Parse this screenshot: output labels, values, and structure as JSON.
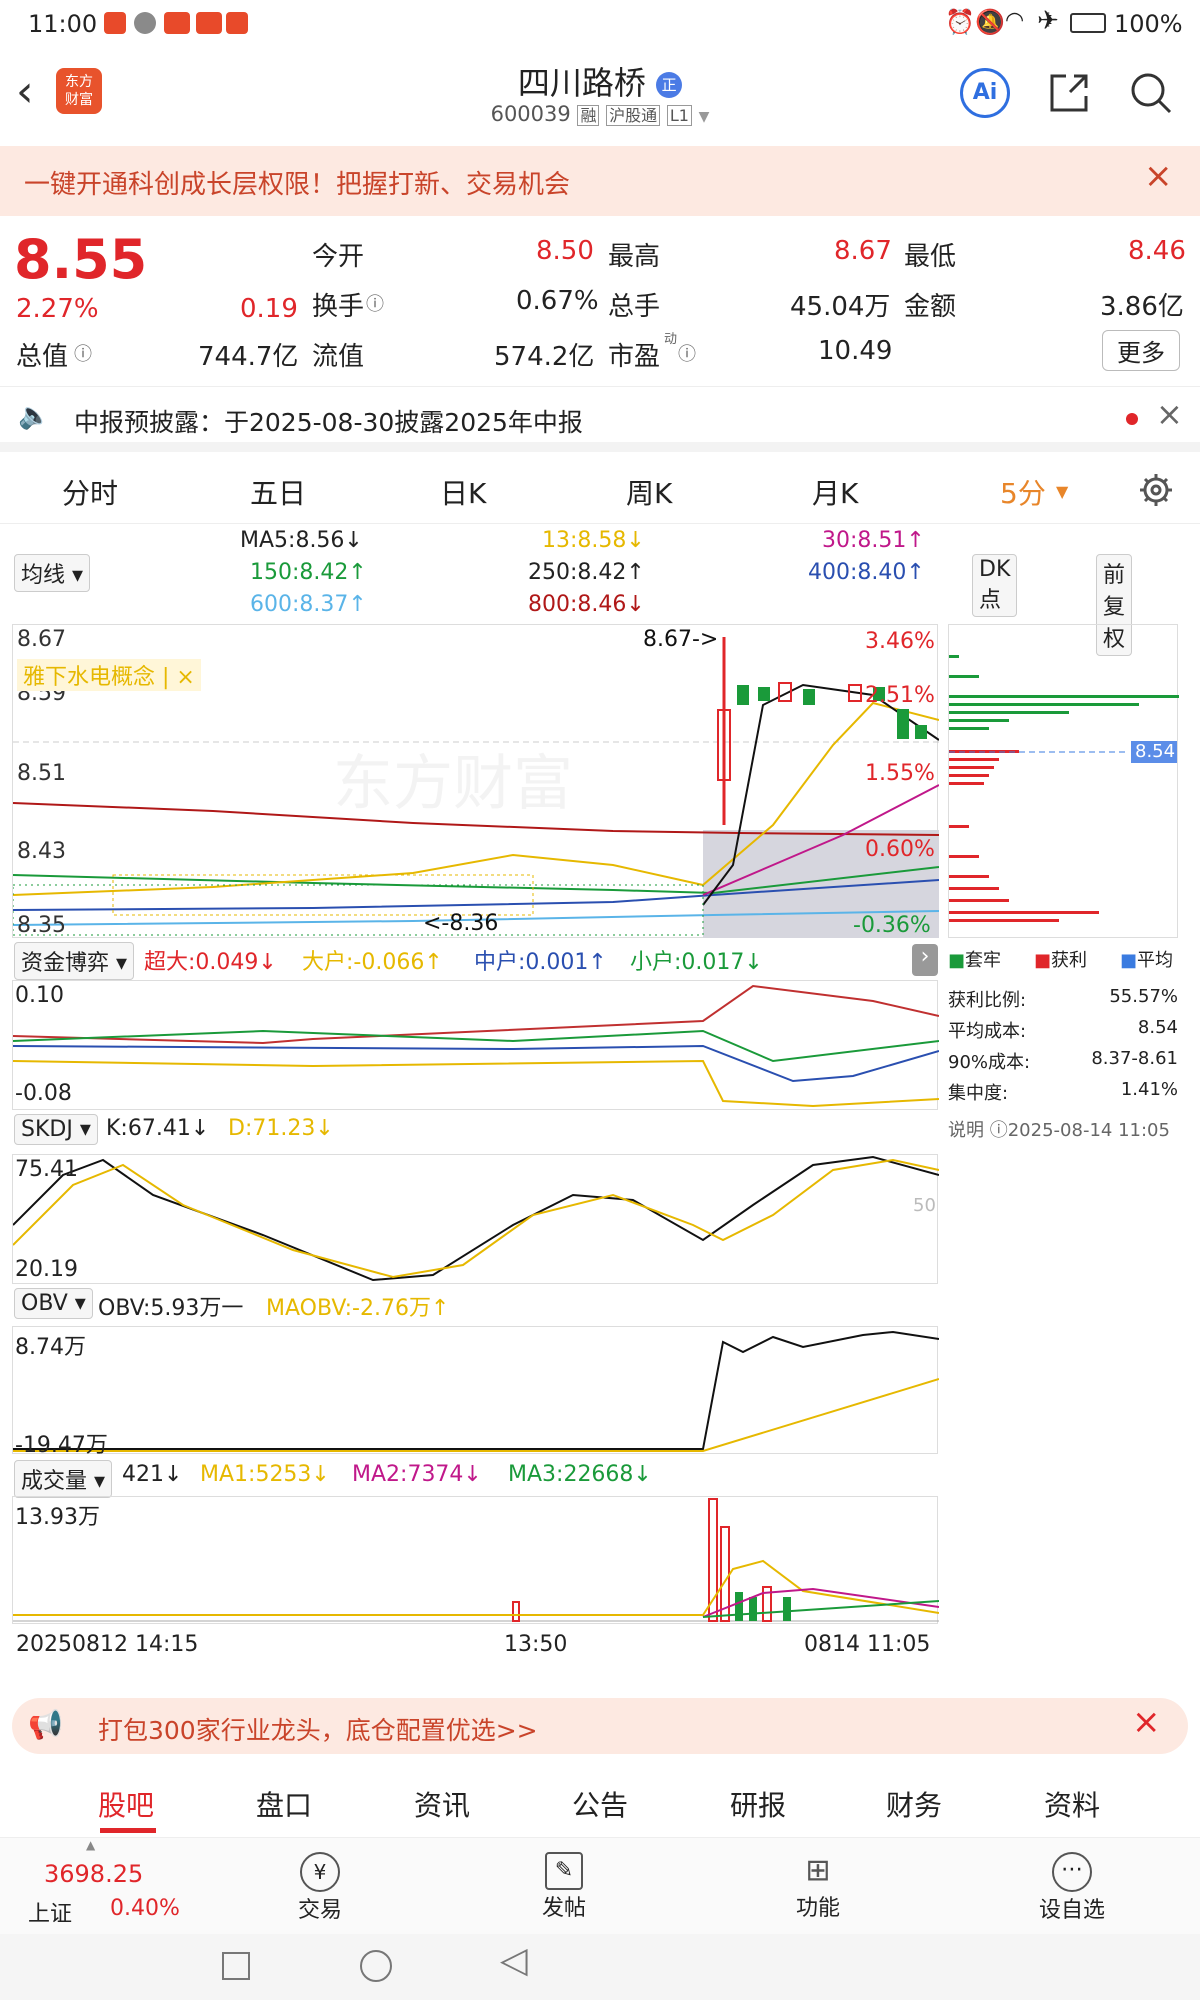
{
  "status": {
    "time": "11:00",
    "battery": "100%"
  },
  "nav": {
    "logo": "东方\n财富",
    "title": "四川路桥",
    "title_badge": "正",
    "code": "600039",
    "tags": [
      "融",
      "沪股通",
      "L1"
    ],
    "ai": "Ai"
  },
  "banner1": {
    "text": "一键开通科创成长层权限！把握打新、交易机会"
  },
  "quote": {
    "price": "8.55",
    "pct": "2.27%",
    "chg": "0.19",
    "open_l": "今开",
    "open": "8.50",
    "high_l": "最高",
    "high": "8.67",
    "low_l": "最低",
    "low": "8.46",
    "turn_l": "换手",
    "turn": "0.67%",
    "vol_l": "总手",
    "vol": "45.04万",
    "amt_l": "金额",
    "amt": "3.86亿",
    "mcap_l": "总值",
    "mcap": "744.7亿",
    "float_l": "流值",
    "float": "574.2亿",
    "pe_l": "市盈",
    "pe_sup": "动",
    "pe": "10.49",
    "more": "更多"
  },
  "notice": {
    "text": "中报预披露：于2025-08-30披露2025年中报"
  },
  "tabs": [
    "分时",
    "五日",
    "日K",
    "周K",
    "月K",
    "5分"
  ],
  "ma": {
    "indicator": "均线",
    "ma5": "MA5:8.56↓",
    "ma13": "13:8.58↓",
    "ma30": "30:8.51↑",
    "ma150": "150:8.42↑",
    "ma250": "250:8.42↑",
    "ma400": "400:8.40↑",
    "ma600": "600:8.37↑",
    "ma800": "800:8.46↓",
    "dk": "DK点",
    "fq": "前复权"
  },
  "main_chart": {
    "y": [
      "8.67",
      "8.59",
      "8.51",
      "8.43",
      "8.35"
    ],
    "pct": [
      "3.46%",
      "2.51%",
      "1.55%",
      "0.60%",
      "-0.36%"
    ],
    "hi": "8.67->",
    "lo": "<-8.36",
    "concept": "雅下水电概念 | ×",
    "cur": "8.54",
    "watermark": "东方财富"
  },
  "chip": {
    "legend": [
      "套牢",
      "获利",
      "平均"
    ],
    "rows": [
      [
        "获利比例:",
        "55.57%"
      ],
      [
        "平均成本:",
        "8.54"
      ],
      [
        "90%成本:",
        "8.37-8.61"
      ],
      [
        "集中度:",
        "1.41%"
      ]
    ],
    "note": "说明",
    "time": "2025-08-14 11:05"
  },
  "fund": {
    "name": "资金博弈",
    "items": [
      "超大:0.049↓",
      "大户:-0.066↑",
      "中户:0.001↑",
      "小户:0.017↓"
    ],
    "ytop": "0.10",
    "ybot": "-0.08"
  },
  "skdj": {
    "name": "SKDJ",
    "k": "K:67.41↓",
    "d": "D:71.23↓",
    "ytop": "75.41",
    "ybot": "20.19",
    "mid": "50"
  },
  "obv": {
    "name": "OBV",
    "obv": "OBV:5.93万一",
    "maobv": "MAOBV:-2.76万↑",
    "ytop": "8.74万",
    "ybot": "-19.47万"
  },
  "volume": {
    "name": "成交量",
    "v": "421↓",
    "ma1": "MA1:5253↓",
    "ma2": "MA2:7374↓",
    "ma3": "MA3:22668↓",
    "ytop": "13.93万",
    "x": [
      "20250812 14:15",
      "13:50",
      "0814 11:05"
    ]
  },
  "banner2": {
    "text": "打包300家行业龙头，底仓配置优选>>"
  },
  "bottomtabs": [
    "股吧",
    "盘口",
    "资讯",
    "公告",
    "研报",
    "财务",
    "资料"
  ],
  "footer": {
    "index": "3698.25",
    "name": "上证",
    "pct": "0.40%",
    "items": [
      "交易",
      "发帖",
      "功能",
      "设自选"
    ]
  }
}
